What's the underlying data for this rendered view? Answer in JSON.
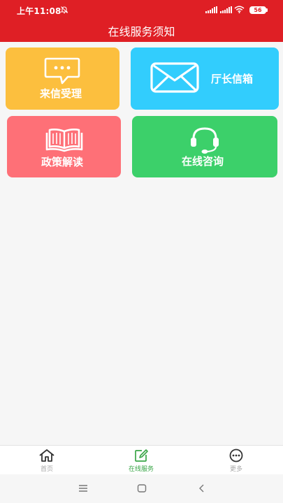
{
  "status_bar": {
    "time": "上午11:08",
    "battery": "56"
  },
  "header": {
    "title": "在线服务须知"
  },
  "tiles": [
    {
      "label": "来信受理",
      "icon": "chat-bubble-icon",
      "color": "#fcbf3e"
    },
    {
      "label": "厅长信箱",
      "icon": "envelope-icon",
      "color": "#32cdfd"
    },
    {
      "label": "政策解读",
      "icon": "open-book-icon",
      "color": "#fe7077"
    },
    {
      "label": "在线咨询",
      "icon": "headset-icon",
      "color": "#3cd06a"
    }
  ],
  "tabbar": {
    "items": [
      {
        "label": "首页",
        "icon": "home-icon",
        "active": false
      },
      {
        "label": "在线服务",
        "icon": "edit-icon",
        "active": true
      },
      {
        "label": "更多",
        "icon": "more-dots-icon",
        "active": false
      }
    ],
    "active_color": "#3aa648"
  },
  "theme": {
    "primary": "#df1f25",
    "background": "#f6f6f6"
  }
}
